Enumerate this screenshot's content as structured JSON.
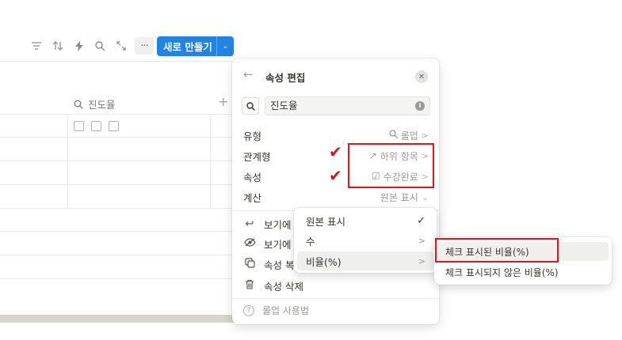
{
  "toolbar": {
    "icons": [
      "filter-icon",
      "sort-icon",
      "automation-icon",
      "search-icon",
      "expand-icon",
      "more-icon"
    ],
    "more_label": "···",
    "new_button_label": "새로 만들기",
    "new_button_chevron": "⌄"
  },
  "table": {
    "column_header": "진도율",
    "column_icon": "search-icon",
    "add_column": "+"
  },
  "panel": {
    "back": "←",
    "title": "속성 편집",
    "close": "✕",
    "name_value": "진도율",
    "info": "i",
    "rows": [
      {
        "key": "유형",
        "value": "롤업",
        "icon": "🔍"
      },
      {
        "key": "관계형",
        "value": "하위 항목",
        "icon": "↗"
      },
      {
        "key": "속성",
        "value": "수강완료",
        "icon": "☑"
      },
      {
        "key": "계산",
        "value": "원본 표시",
        "icon": ""
      }
    ],
    "actions": [
      {
        "label": "보기에",
        "icon": "↩"
      },
      {
        "label": "보기에",
        "icon": "👁"
      },
      {
        "label": "속성 복",
        "icon": "⧉"
      },
      {
        "label": "속성 삭제",
        "icon": "🗑"
      }
    ],
    "help": "롤업 사용법"
  },
  "calc_menu": {
    "items": [
      {
        "label": "원본 표시",
        "right": "✓"
      },
      {
        "label": "수",
        "right": ">"
      },
      {
        "label": "비율(%)",
        "right": ">"
      }
    ]
  },
  "ratio_menu": {
    "items": [
      {
        "label": "체크 표시된 비율(%)"
      },
      {
        "label": "체크 표시되지 않은 비율(%)"
      }
    ]
  },
  "annotations": {
    "check_mark": "✔",
    "color": "#e0161c"
  },
  "colors": {
    "accent": "#2383e2"
  }
}
